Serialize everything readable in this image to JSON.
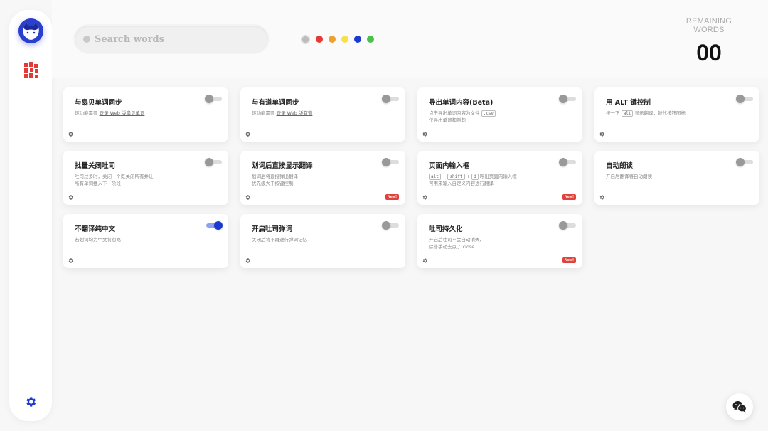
{
  "search": {
    "placeholder": "Search words"
  },
  "colors": {
    "selected": "#bbbbbb",
    "options": [
      "#e53935",
      "#f0a030",
      "#f7e04b",
      "#1b39d1",
      "#4cc04a"
    ]
  },
  "remaining": {
    "label": "REMAINING WORDS",
    "count": "00"
  },
  "accent": "#1b39d1",
  "cards": [
    {
      "title": "与扇贝单词同步",
      "desc_pre": "该功能需要 ",
      "desc_link": "登录 Web 版扇贝单词",
      "on": false,
      "new": false
    },
    {
      "title": "与有道单词同步",
      "desc_pre": "该功能需要 ",
      "desc_link": "登录 Web 版有道",
      "on": false,
      "new": false
    },
    {
      "title": "导出单词内容(Beta)",
      "desc_pre": "点击导出单词内容为文件 ",
      "desc_kbd": ".csv",
      "desc_line2": "仅导出单词和例句",
      "on": false,
      "new": false
    },
    {
      "title": "用 ALT 键控制",
      "desc_pre": "按一下 ",
      "desc_kbd": "alt",
      "desc_post": " 显示翻译，替代按钮图标",
      "on": false,
      "new": false
    },
    {
      "title": "批量关闭吐司",
      "desc_pre": "吐司过多时，关闭一个既关闭所有并让",
      "desc_line2": "所有单词推入下一阶段",
      "on": false,
      "new": false
    },
    {
      "title": "划词后直接显示翻译",
      "desc_pre": "划词后将直接弹出翻译",
      "desc_line2": "优先级大于按键控制",
      "on": false,
      "new": true
    },
    {
      "title": "页面内输入框",
      "desc_keys": [
        "alt",
        "shift",
        "d"
      ],
      "desc_post": " 呼出页面内输入框",
      "desc_line2": "可用来输入自定义内容进行翻译",
      "on": false,
      "new": true
    },
    {
      "title": "自动朗读",
      "desc_pre": "开启后翻译将自动朗读",
      "on": false,
      "new": false
    },
    {
      "title": "不翻译纯中文",
      "desc_pre": "若划词均为中文将忽略",
      "on": true,
      "new": false
    },
    {
      "title": "开启吐司弹词",
      "desc_pre": "关闭后将不再进行弹词记忆",
      "on": false,
      "new": false
    },
    {
      "title": "吐司持久化",
      "desc_pre": "开启后吐司不会自动消失,",
      "desc_line2": "除非手动去点了 close",
      "on": false,
      "new": true
    }
  ],
  "new_badge": "New!",
  "icons": {
    "logo": "cat-logo-icon",
    "grid": "grid-icon",
    "settings": "gear-icon",
    "card_settings": "small-gear-icon",
    "chat": "wechat-icon",
    "search": "search-icon"
  }
}
